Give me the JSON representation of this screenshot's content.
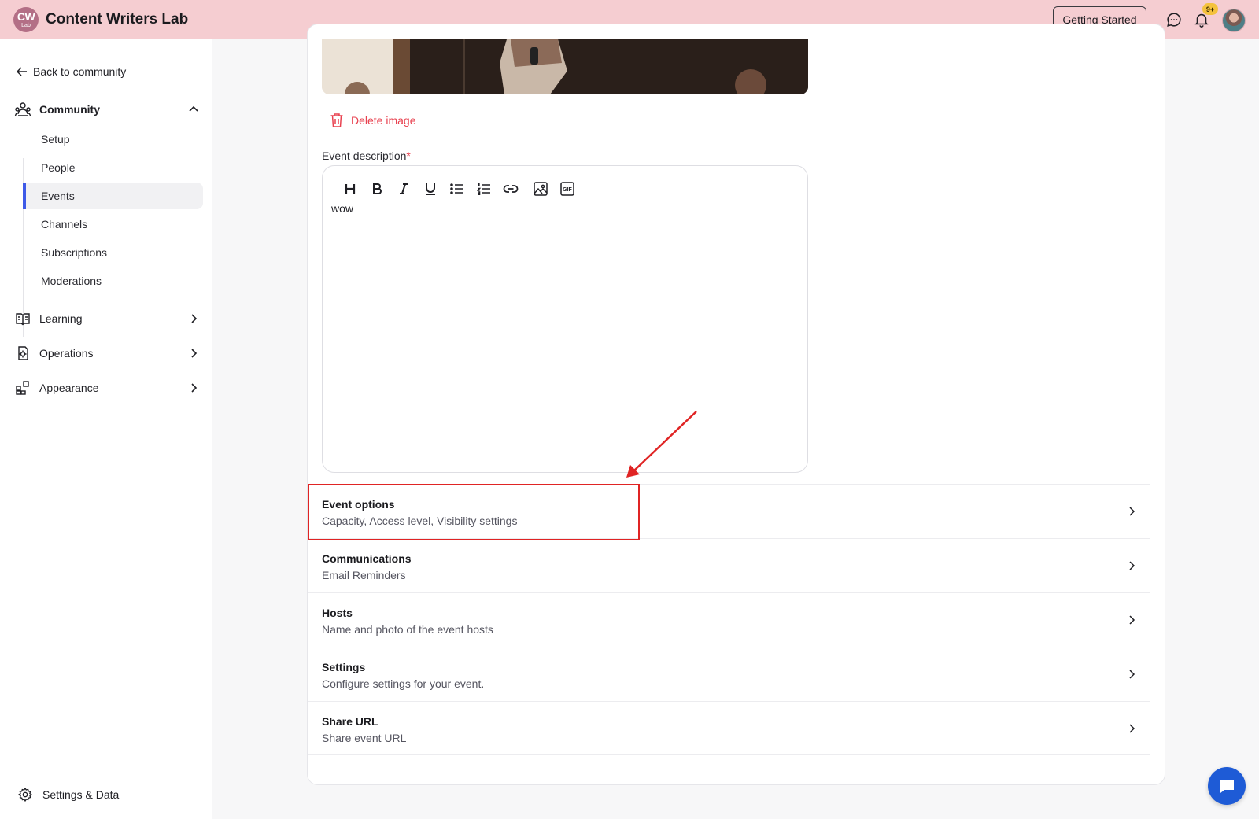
{
  "header": {
    "logo_text": "CW",
    "logo_sub": "Lab",
    "title": "Content Writers Lab",
    "getting_started": "Getting Started",
    "notif_badge": "9+"
  },
  "sidebar": {
    "back": "Back to community",
    "community": "Community",
    "sub_items": [
      "Setup",
      "People",
      "Events",
      "Channels",
      "Subscriptions",
      "Moderations"
    ],
    "active_sub": "Events",
    "learning": "Learning",
    "operations": "Operations",
    "appearance": "Appearance",
    "settings_data": "Settings & Data"
  },
  "main": {
    "delete_image": "Delete image",
    "desc_label": "Event description",
    "required_mark": "*",
    "editor_text": "wow",
    "toolbar": [
      "heading-icon",
      "bold-icon",
      "italic-icon",
      "underline-icon",
      "bullet-list-icon",
      "numbered-list-icon",
      "link-icon",
      "image-icon",
      "gif-icon"
    ],
    "options": [
      {
        "title": "Event options",
        "subtitle": "Capacity, Access level, Visibility settings"
      },
      {
        "title": "Communications",
        "subtitle": "Email Reminders"
      },
      {
        "title": "Hosts",
        "subtitle": "Name and photo of the event hosts"
      },
      {
        "title": "Settings",
        "subtitle": "Configure settings for your event."
      },
      {
        "title": "Share URL",
        "subtitle": "Share event URL"
      }
    ]
  },
  "colors": {
    "header_bg": "#f5cdd1",
    "accent": "#3e5ae8",
    "danger": "#e8414f",
    "annotation": "#e02424",
    "fab": "#1e5bd6"
  }
}
